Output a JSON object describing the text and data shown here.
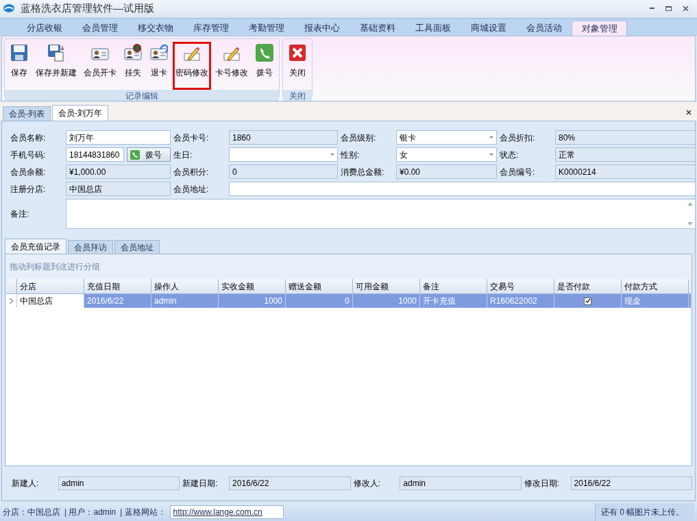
{
  "window": {
    "title": "蓝格洗衣店管理软件—试用版"
  },
  "menu_tabs": [
    {
      "label": "分店收银",
      "selected": false
    },
    {
      "label": "会员管理",
      "selected": false
    },
    {
      "label": "移交衣物",
      "selected": false
    },
    {
      "label": "库存管理",
      "selected": false
    },
    {
      "label": "考勤管理",
      "selected": false
    },
    {
      "label": "报表中心",
      "selected": false
    },
    {
      "label": "基础资料",
      "selected": false
    },
    {
      "label": "工具面板",
      "selected": false
    },
    {
      "label": "商城设置",
      "selected": false
    },
    {
      "label": "会员活动",
      "selected": false
    },
    {
      "label": "对象管理",
      "selected": true
    }
  ],
  "ribbon_groups": [
    {
      "title": "记录编辑",
      "buttons": [
        {
          "label": "保存",
          "kind": "save",
          "highlighted": false
        },
        {
          "label": "保存并新建",
          "kind": "save-new",
          "highlighted": false
        },
        {
          "label": "会员开卡",
          "kind": "card",
          "highlighted": false
        },
        {
          "label": "挂失",
          "kind": "lost",
          "highlighted": false
        },
        {
          "label": "退卡",
          "kind": "return",
          "highlighted": false
        },
        {
          "label": "密码修改",
          "kind": "edit",
          "highlighted": true
        },
        {
          "label": "卡号修改",
          "kind": "edit",
          "highlighted": false
        },
        {
          "label": "拨号",
          "kind": "phone",
          "highlighted": false
        }
      ]
    },
    {
      "title": "关闭",
      "buttons": [
        {
          "label": "关闭",
          "kind": "close",
          "highlighted": false
        }
      ]
    }
  ],
  "doc_tabs": [
    {
      "label": "会员-列表",
      "selected": false
    },
    {
      "label": "会员-刘万年",
      "selected": true
    }
  ],
  "form": {
    "fields": [
      {
        "label": "会员名称:",
        "kind": "text",
        "value": "刘万年"
      },
      {
        "label": "会员卡号:",
        "kind": "readonly",
        "value": "1860"
      },
      {
        "label": "会员级别:",
        "kind": "combo",
        "value": "银卡"
      },
      {
        "label": "会员折扣:",
        "kind": "readonly",
        "value": "80%"
      },
      {
        "label": "手机号码:",
        "kind": "phone",
        "value": "18144831860",
        "button": "拨号"
      },
      {
        "label": "生日:",
        "kind": "combo"
      },
      {
        "label": "性别:",
        "kind": "combo",
        "value": "女"
      },
      {
        "label": "状态:",
        "kind": "readonly",
        "value": "正常"
      },
      {
        "label": "会员余额:",
        "kind": "readonly",
        "value": "¥1,000.00"
      },
      {
        "label": "会员积分:",
        "kind": "readonly",
        "value": "0"
      },
      {
        "label": "消费总金额:",
        "kind": "readonly",
        "value": "¥0.00"
      },
      {
        "label": "会员编号:",
        "kind": "readonly",
        "value": "K0000214"
      },
      {
        "label": "注册分店:",
        "kind": "readonly",
        "value": "中国总店"
      },
      {
        "label": "会员地址:",
        "kind": "wide"
      },
      {
        "label": "备注:",
        "kind": "memo"
      }
    ]
  },
  "sub_tabs": [
    {
      "label": "会员充值记录",
      "selected": true
    },
    {
      "label": "会员拜访",
      "selected": false
    },
    {
      "label": "会员地址",
      "selected": false
    }
  ],
  "grid": {
    "group_hint": "拖动列标题到这进行分组",
    "columns": [
      {
        "label": "分店",
        "kind": "text"
      },
      {
        "label": "充值日期",
        "kind": "text"
      },
      {
        "label": "操作人",
        "kind": "text"
      },
      {
        "label": "实收金额",
        "kind": "number"
      },
      {
        "label": "赠送金额",
        "kind": "number"
      },
      {
        "label": "可用金额",
        "kind": "number"
      },
      {
        "label": "备注",
        "kind": "text"
      },
      {
        "label": "交易号",
        "kind": "text"
      },
      {
        "label": "是否付款",
        "kind": "check"
      },
      {
        "label": "付款方式",
        "kind": "text"
      }
    ],
    "rows": [
      {
        "selected": true,
        "cells": [
          "中国总店",
          "2016/6/22",
          "admin",
          "1000",
          "0",
          "1000",
          "开卡充值",
          "R160622002",
          true,
          "现金"
        ]
      }
    ]
  },
  "footer": [
    {
      "label": "新建人:",
      "value": "admin"
    },
    {
      "label": "新建日期:",
      "value": "2016/6/22"
    },
    {
      "label": "修改人:",
      "value": "admin"
    },
    {
      "label": "修改日期:",
      "value": "2016/6/22"
    }
  ],
  "status_bar": {
    "items": [
      "分店：中国总店",
      "| 用户：admin",
      "| 蓝格网站："
    ],
    "link": "http://www.lange.com.cn",
    "right": "还有 0 幅图片未上传。"
  }
}
